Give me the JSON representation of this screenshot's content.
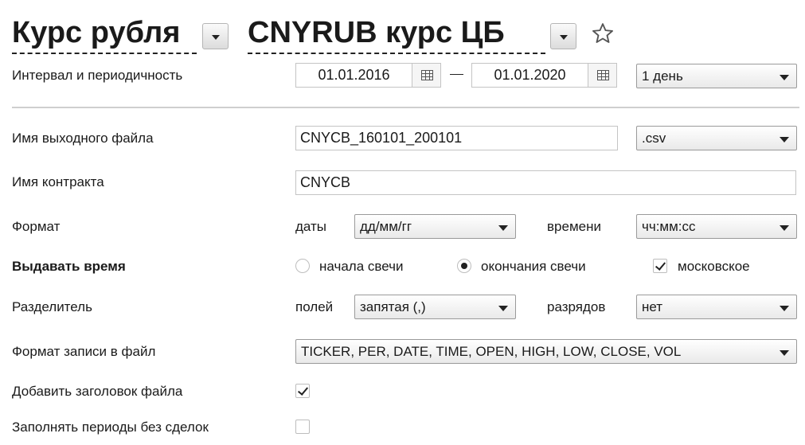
{
  "header": {
    "title_left": "Курс рубля",
    "title_right": "CNYRUB курс ЦБ",
    "left_dropdown_icon": "chevron-down-icon",
    "right_dropdown_icon": "chevron-down-icon",
    "favorite_icon": "star-icon"
  },
  "interval": {
    "label": "Интервал и периодичность",
    "date_from": "01.01.2016",
    "date_to": "01.01.2020",
    "period": "1 день"
  },
  "output_file": {
    "label": "Имя выходного файла",
    "value": "CNYCB_160101_200101",
    "extension": ".csv"
  },
  "contract": {
    "label": "Имя контракта",
    "value": "CNYCB"
  },
  "format": {
    "label": "Формат",
    "date_label": "даты",
    "date_value": "дд/мм/гг",
    "time_label": "времени",
    "time_value": "чч:мм:сс"
  },
  "output_time": {
    "label": "Выдавать время",
    "option_start": "начала свечи",
    "option_end": "окончания свечи",
    "moscow_label": "московское",
    "selected": "end",
    "moscow_checked": true
  },
  "separator": {
    "label": "Разделитель",
    "fields_label": "полей",
    "fields_value": "запятая (,)",
    "digits_label": "разрядов",
    "digits_value": "нет"
  },
  "record_format": {
    "label": "Формат записи в файл",
    "value": "TICKER, PER, DATE, TIME, OPEN, HIGH, LOW, CLOSE, VOL"
  },
  "add_header": {
    "label": "Добавить заголовок файла",
    "checked": true
  },
  "fill_periods": {
    "label": "Заполнять периоды без сделок",
    "checked": false
  }
}
